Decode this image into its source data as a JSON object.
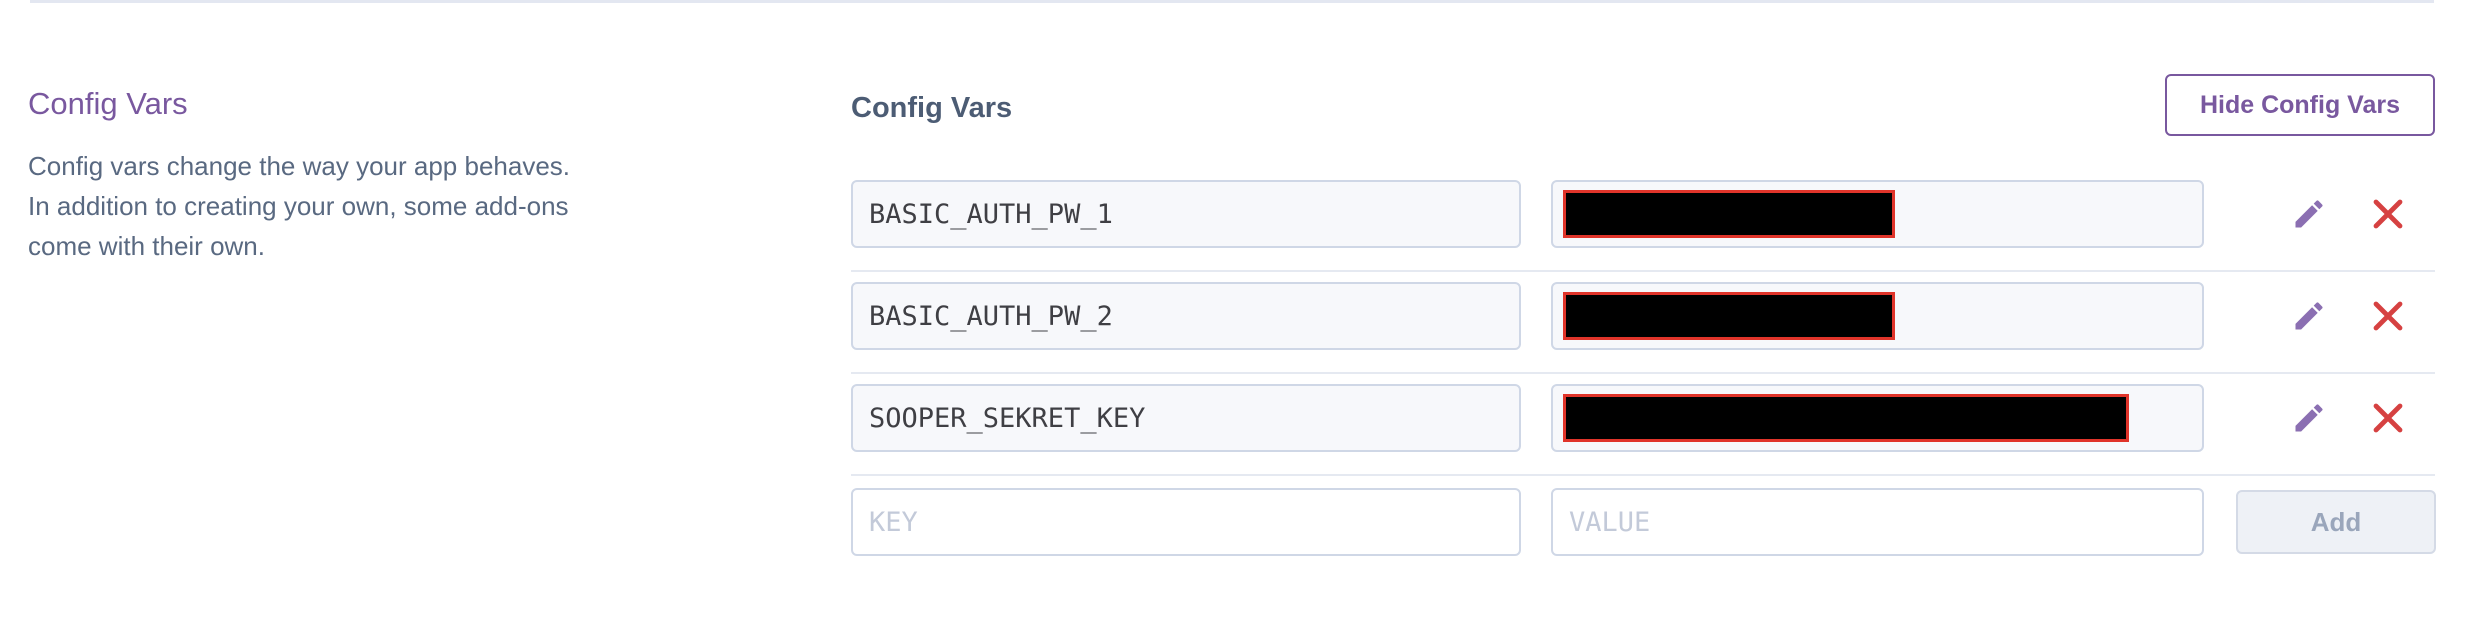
{
  "section": {
    "title": "Config Vars",
    "description": "Config vars change the way your app behaves. In addition to creating your own, some add-ons come with their own."
  },
  "panel": {
    "title": "Config Vars",
    "hide_button_label": "Hide Config Vars"
  },
  "config_vars": [
    {
      "key": "BASIC_AUTH_PW_1",
      "value_redacted": true
    },
    {
      "key": "BASIC_AUTH_PW_2",
      "value_redacted": true
    },
    {
      "key": "SOOPER_SEKRET_KEY",
      "value_redacted": true
    }
  ],
  "new_var": {
    "key_placeholder": "KEY",
    "value_placeholder": "VALUE",
    "add_label": "Add"
  },
  "icons": {
    "edit": "pencil-icon",
    "delete": "close-icon"
  },
  "colors": {
    "accent": "#79589f",
    "delete": "#d64141",
    "redaction_fill": "#000000",
    "redaction_border": "#e0342a"
  }
}
